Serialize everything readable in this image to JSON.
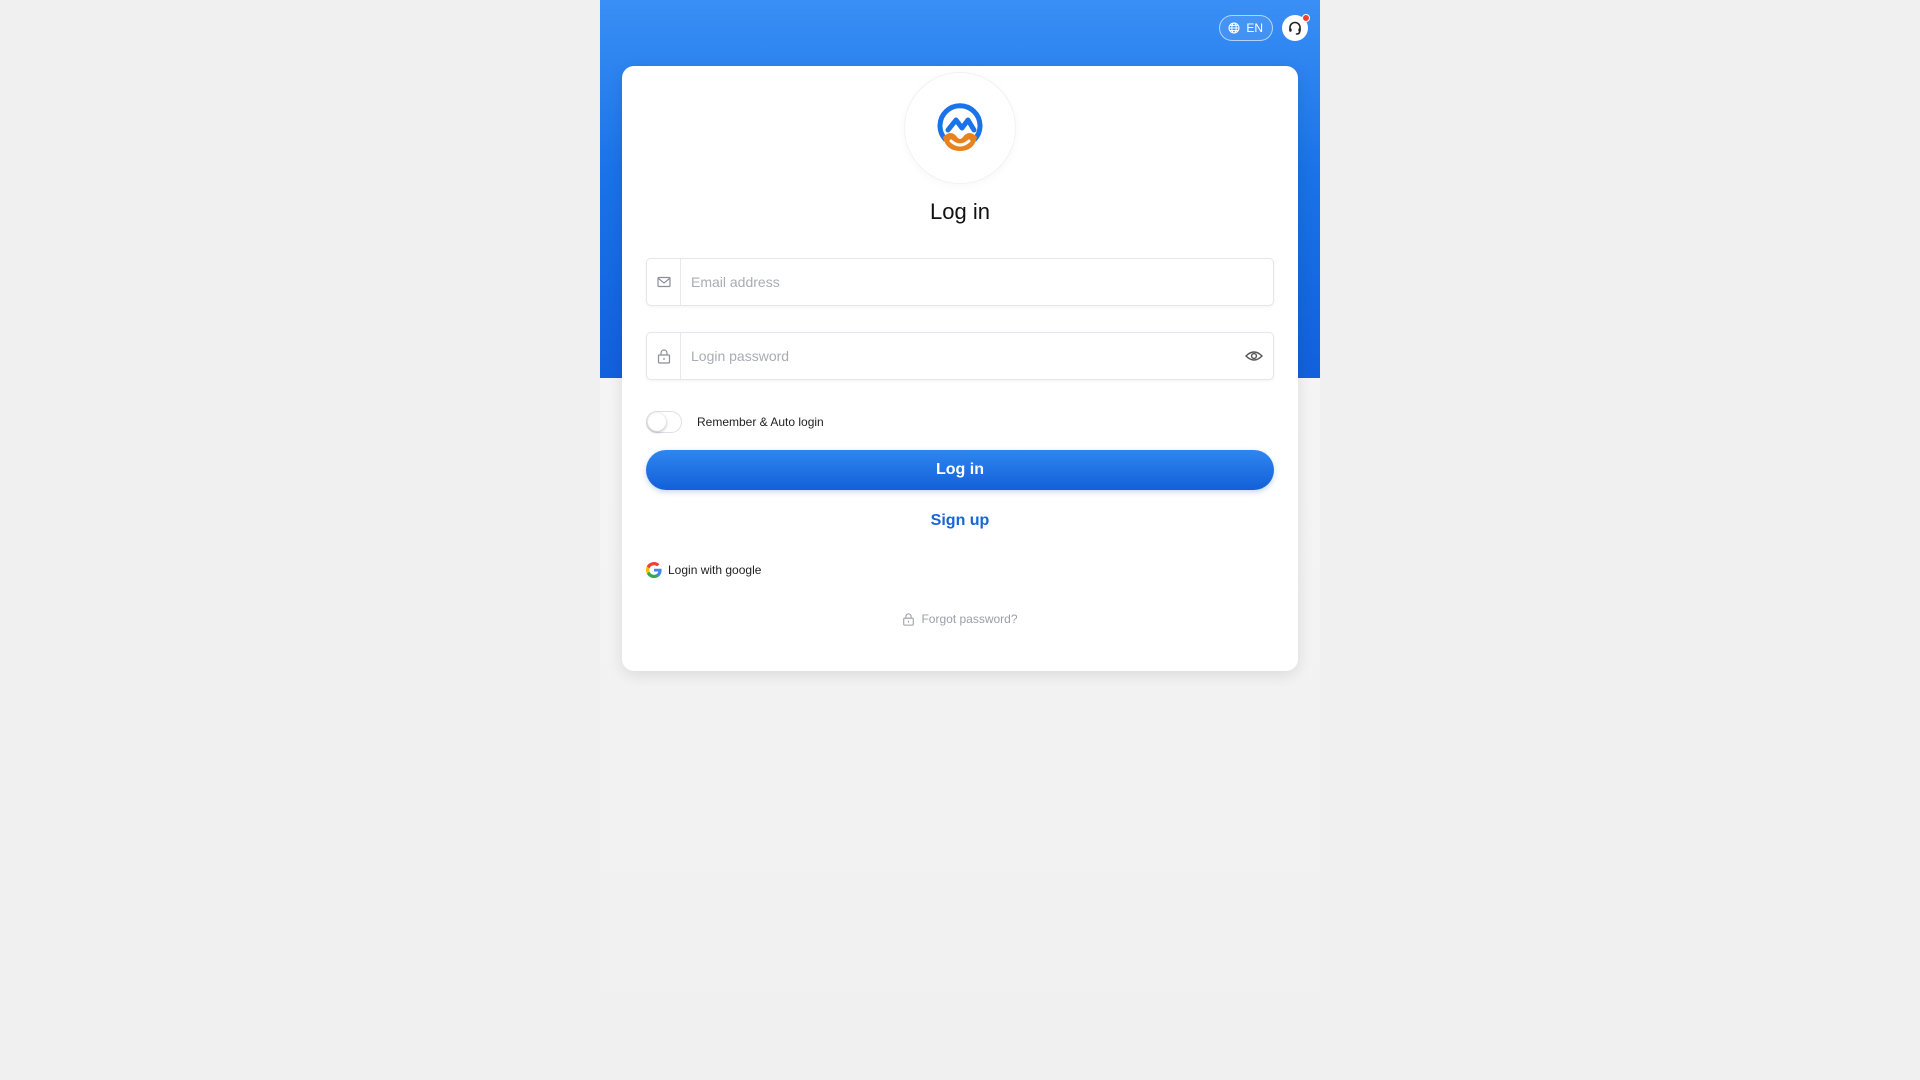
{
  "topbar": {
    "language_label": "EN",
    "language_icon": "globe-icon",
    "support_icon": "headset-icon",
    "support_badge_color": "#ff3b30"
  },
  "login_form": {
    "title": "Log in",
    "email": {
      "icon": "mail-icon",
      "placeholder": "Email address",
      "value": ""
    },
    "password": {
      "icon": "lock-icon",
      "placeholder": "Login password",
      "value": "",
      "toggle_icon": "eye-icon"
    },
    "remember": {
      "label": "Remember & Auto login",
      "enabled": false
    },
    "submit_label": "Log in",
    "signup_label": "Sign up",
    "google_label": "Login with google",
    "forgot_label": "Forgot password?"
  },
  "colors": {
    "brand_blue": "#1a73e8",
    "logo_orange": "#e8821e",
    "link_blue": "#1565d8"
  }
}
